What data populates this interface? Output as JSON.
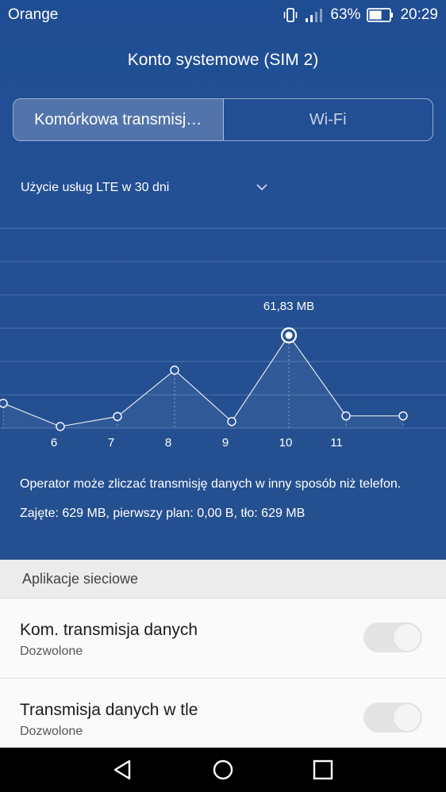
{
  "status": {
    "carrier": "Orange",
    "battery_percent": "63%",
    "time": "20:29",
    "battery_level": 0.63
  },
  "header": {
    "title": "Konto systemowe (SIM 2)"
  },
  "tabs": [
    {
      "label": "Komórkowa transmisj…",
      "active": true
    },
    {
      "label": "Wi-Fi",
      "active": false
    }
  ],
  "period": {
    "label": "Użycie usług LTE w 30 dni"
  },
  "chart_data": {
    "type": "line",
    "x": [
      "5",
      "6",
      "7",
      "8",
      "9",
      "10",
      "11",
      "12"
    ],
    "tick_labels": [
      "6",
      "7",
      "8",
      "9",
      "10",
      "11"
    ],
    "values_mb": [
      7.5,
      0.5,
      3.5,
      17.5,
      2,
      28,
      3.7,
      3.7
    ],
    "selected_index": 5,
    "selected_label": "61,83 MB",
    "grid": true
  },
  "info": {
    "note": "Operator może zliczać transmisję danych w inny sposób niż telefon.",
    "usage": "Zajęte: 629 MB, pierwszy plan: 0,00 B, tło: 629 MB"
  },
  "section": {
    "title": "Aplikacje sieciowe"
  },
  "rows": [
    {
      "title": "Kom. transmisja danych",
      "subtitle": "Dozwolone",
      "enabled": true
    },
    {
      "title": "Transmisja danych w tle",
      "subtitle": "Dozwolone",
      "enabled": true
    }
  ],
  "colors": {
    "background_blue": "#234f94",
    "grid_line": "#4c72aa"
  },
  "icons": [
    "vibrate-icon",
    "signal-icon",
    "battery-icon",
    "chevron-down-icon",
    "back-icon",
    "home-icon",
    "recents-icon"
  ]
}
